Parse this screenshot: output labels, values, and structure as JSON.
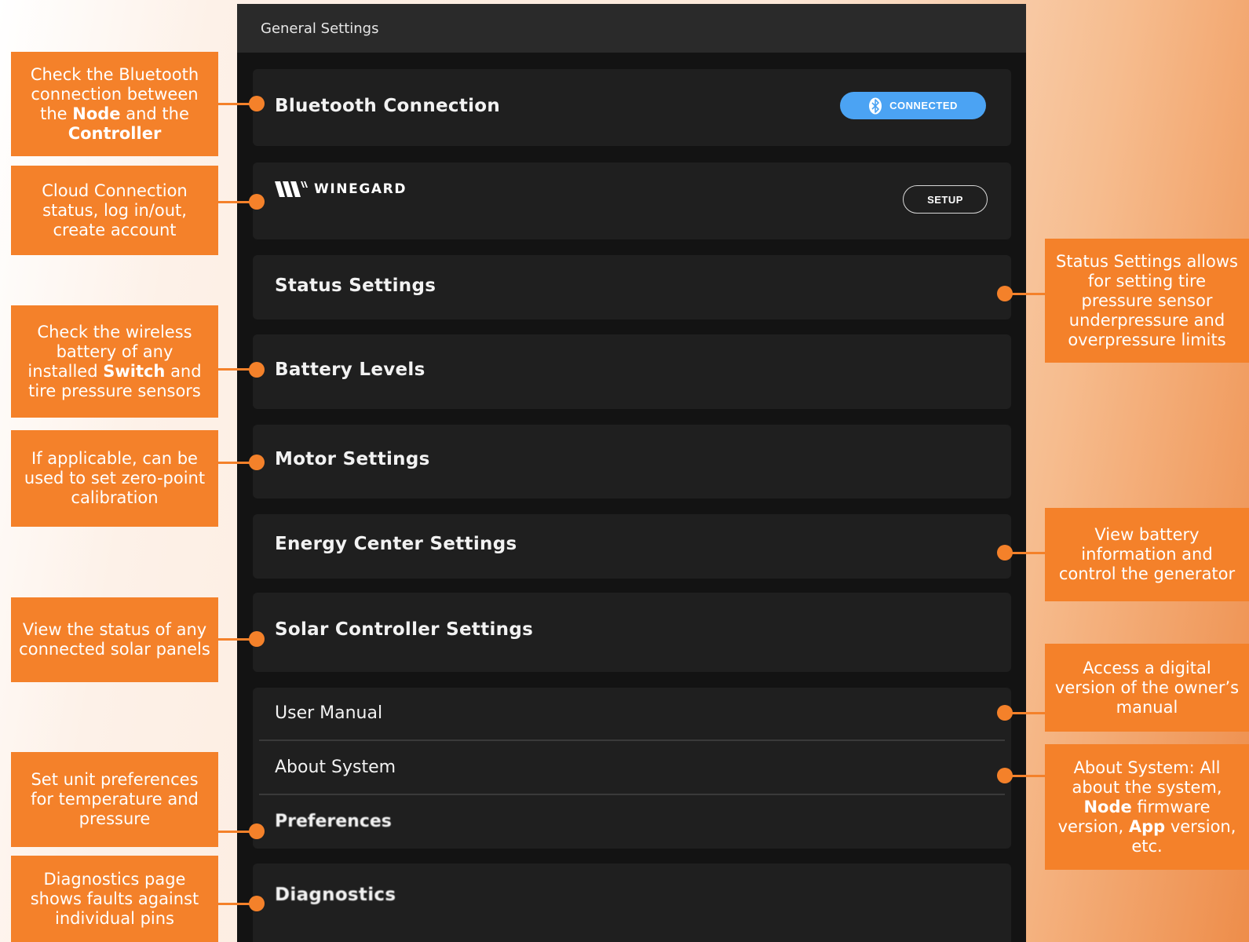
{
  "header": {
    "title": "General Settings"
  },
  "bluetooth": {
    "title": "Bluetooth Connection",
    "status": "CONNECTED"
  },
  "cloud": {
    "brand": "WINEGARD",
    "button": "SETUP"
  },
  "menu": {
    "status_settings": "Status Settings",
    "battery_levels": "Battery Levels",
    "motor_settings": "Motor Settings",
    "energy_center": "Energy Center Settings",
    "solar_controller": "Solar Controller Settings",
    "user_manual": "User Manual",
    "about_system": "About System",
    "preferences": "Preferences",
    "diagnostics": "Diagnostics"
  },
  "callouts": {
    "bluetooth": {
      "t1": "Check the Bluetooth connection between the ",
      "b1": "Node",
      "t2": " and the ",
      "b2": "Controller"
    },
    "cloud": "Cloud Connection status, log in/out, create account",
    "battery": {
      "t1": "Check the wireless battery of any installed ",
      "b1": "Switch",
      "t2": " and tire pressure sensors"
    },
    "motor": "If applicable, can be used to set zero-point calibration",
    "solar": "View the status of any connected solar panels",
    "preferences": "Set unit preferences for temperature and pressure",
    "diagnostics": "Diagnostics page shows faults against individual pins",
    "status": "Status Settings allows for setting tire pressure sensor underpressure and overpressure limits",
    "energy": "View battery information and control the generator",
    "manual": "Access a digital version of the owner’s manual",
    "about": {
      "t1": "About System: All about the system, ",
      "b1": "Node",
      "t2": " firmware version, ",
      "b2": "App",
      "t3": " version, etc."
    }
  },
  "colors": {
    "accent": "#f4812a",
    "bluetooth_pill": "#4ba3f3",
    "panel_bg": "#131313",
    "card_bg": "#1f1f1f"
  }
}
